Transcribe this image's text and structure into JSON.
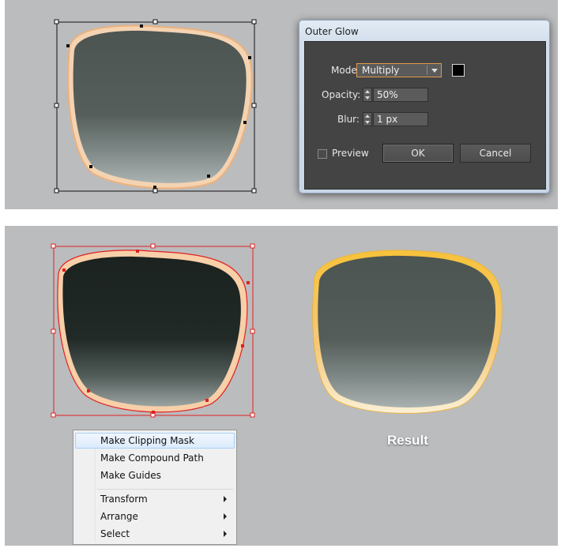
{
  "dialog": {
    "title": "Outer Glow",
    "mode_label": "Mode:",
    "mode_value": "Multiply",
    "opacity_label": "Opacity:",
    "opacity_value": "50%",
    "blur_label": "Blur:",
    "blur_value": "1 px",
    "preview_label": "Preview",
    "preview_checked": false,
    "ok_label": "OK",
    "cancel_label": "Cancel",
    "glow_color": "#000000"
  },
  "context_menu": {
    "items": [
      {
        "label": "Make Clipping Mask",
        "highlighted": true
      },
      {
        "label": "Make Compound Path"
      },
      {
        "label": "Make Guides"
      },
      {
        "label": "Transform",
        "submenu": true
      },
      {
        "label": "Arrange",
        "submenu": true
      },
      {
        "label": "Select",
        "submenu": true
      }
    ]
  },
  "result_label": "Result",
  "colors": {
    "canvas_bg": "#bbbcbe",
    "frame_gold": "#f7c843",
    "frame_peach": "#f3c9a0",
    "selection_red": "#e02020",
    "lens_dark": "#1b221f",
    "lens_gray": "#525b57"
  }
}
